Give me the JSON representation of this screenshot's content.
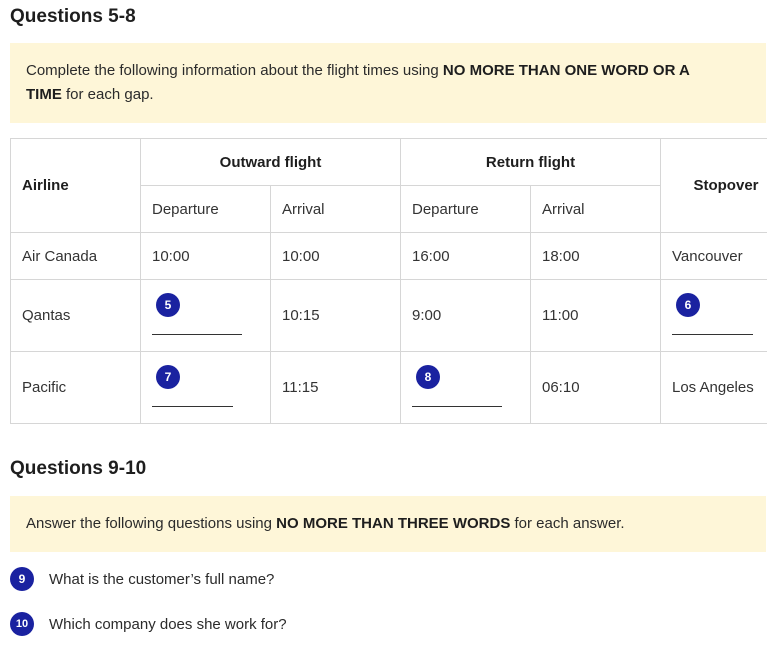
{
  "section1": {
    "heading": "Questions 5-8",
    "instruction_pre": "Complete the following information about the flight times using ",
    "instruction_bold1": "NO MORE THAN ONE WORD OR A",
    "instruction_bold2": "TIME",
    "instruction_post": " for each gap."
  },
  "table": {
    "header": {
      "airline": "Airline",
      "outward": "Outward flight",
      "return": "Return flight",
      "stopover": "Stopover",
      "departure": "Departure",
      "arrival": "Arrival"
    },
    "rows": [
      {
        "airline": "Air Canada",
        "out_dep": "10:00",
        "out_arr": "10:00",
        "ret_dep": "16:00",
        "ret_arr": "18:00",
        "stopover": "Vancouver"
      },
      {
        "airline": "Qantas",
        "out_dep_gap": "5",
        "out_arr": "10:15",
        "ret_dep": "9:00",
        "ret_arr": "11:00",
        "stopover_gap": "6"
      },
      {
        "airline": "Pacific",
        "out_dep_gap": "7",
        "out_arr": "11:15",
        "ret_dep_gap": "8",
        "ret_arr": "06:10",
        "stopover": "Los Angeles"
      }
    ]
  },
  "section2": {
    "heading": "Questions 9-10",
    "instruction_pre": "Answer the following questions using ",
    "instruction_bold": "NO MORE THAN THREE WORDS",
    "instruction_post": " for each answer.",
    "questions": [
      {
        "number": "9",
        "text": "What is the customer’s full name?"
      },
      {
        "number": "10",
        "text": "Which company does she work for?"
      }
    ]
  },
  "colors": {
    "badge": "#1a22a0",
    "instruction_bg": "#fef6d8",
    "border": "#d6d6d6"
  }
}
